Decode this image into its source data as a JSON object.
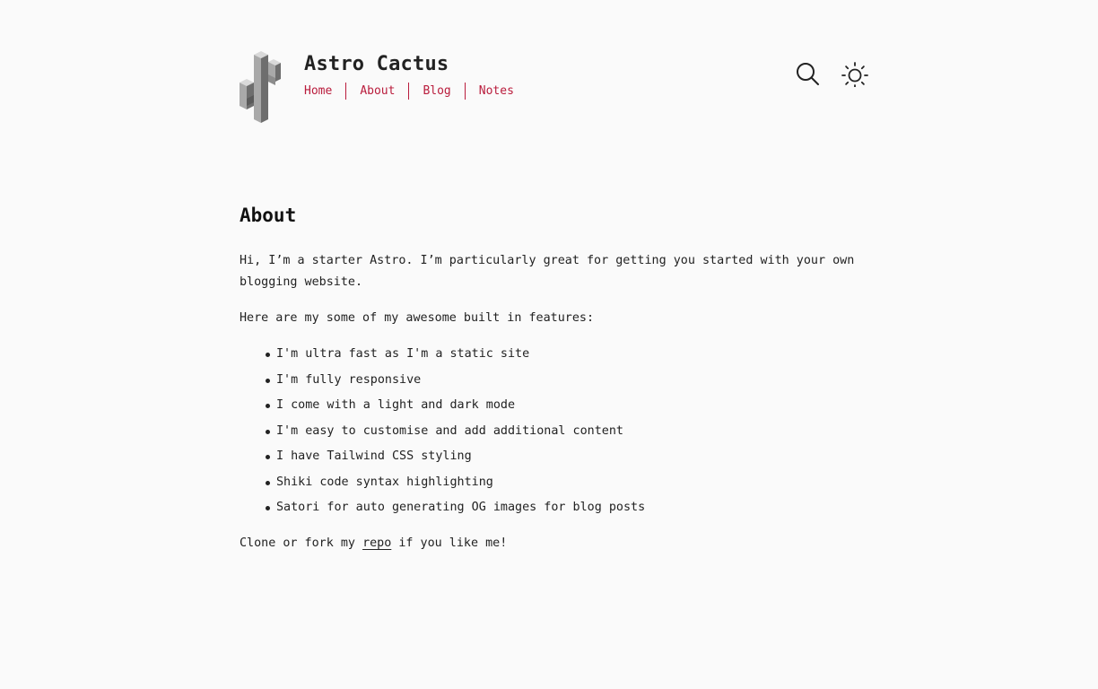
{
  "header": {
    "site_title": "Astro Cactus",
    "nav": [
      "Home",
      "About",
      "Blog",
      "Notes"
    ],
    "icons": {
      "logo": "cactus-logo",
      "search": "search-icon",
      "theme": "sun-icon"
    }
  },
  "main": {
    "title": "About",
    "intro": "Hi, I’m a starter Astro. I’m particularly great for getting you started with your own blogging website.",
    "features_intro": "Here are my some of my awesome built in features:",
    "features": [
      "I'm ultra fast as I'm a static site",
      "I'm fully responsive",
      "I come with a light and dark mode",
      "I'm easy to customise and add additional content",
      "I have Tailwind CSS styling",
      "Shiki code syntax highlighting",
      "Satori for auto generating OG images for blog posts"
    ],
    "closing_before": "Clone or fork my ",
    "closing_link": "repo",
    "closing_after": " if you like me!"
  },
  "colors": {
    "background": "#fafafa",
    "text": "#222222",
    "accent": "#b91c3c"
  }
}
